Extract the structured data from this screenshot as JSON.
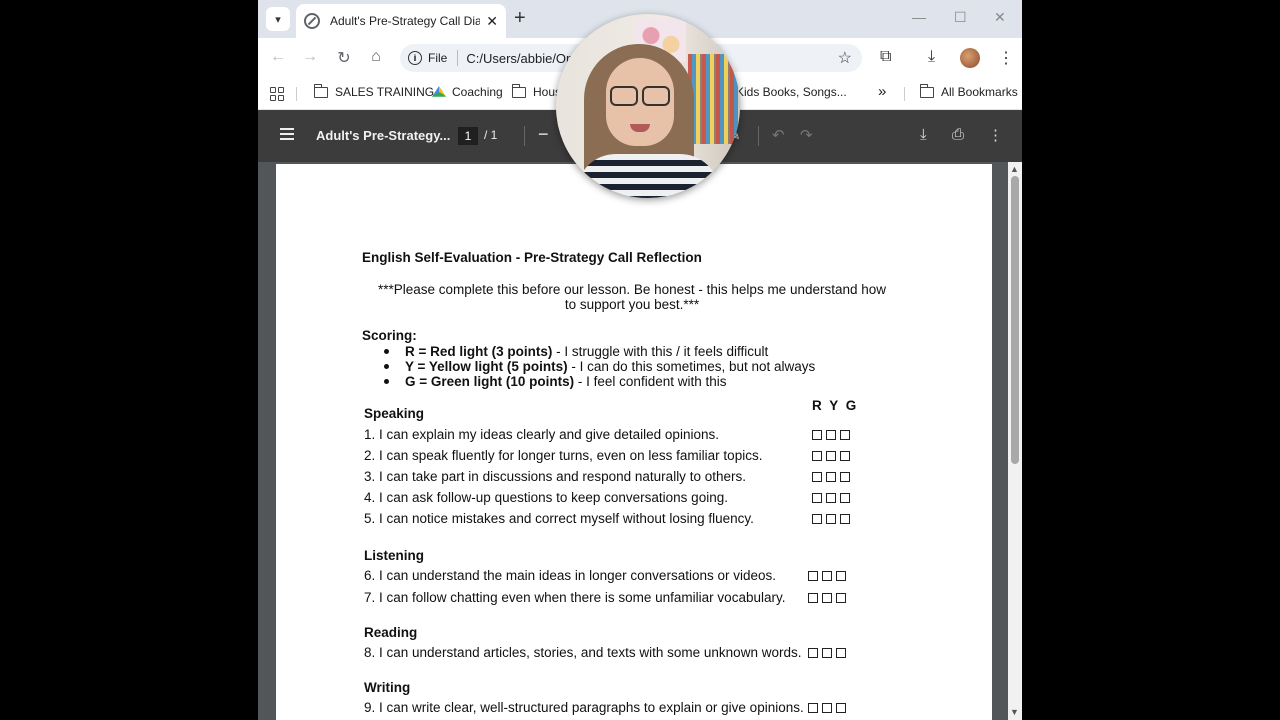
{
  "browser": {
    "tab_title": "Adult's Pre-Strategy Call Diagnos",
    "omnibox": {
      "scheme": "File",
      "url": "C:/Users/abbie/OneD                    l's/Adult's%20Pr..."
    },
    "bookmarks": [
      {
        "label": "SALES TRAINING",
        "icon": "folder-icon"
      },
      {
        "label": "Coaching",
        "icon": "google-drive-icon"
      },
      {
        "label": "Hous",
        "icon": "folder-icon"
      },
      {
        "label": "Kids Books, Songs...",
        "icon": "none"
      }
    ],
    "bookmarks_overflow": "»",
    "all_bookmarks": "All Bookmarks"
  },
  "pdf": {
    "title": "Adult's Pre-Strategy...",
    "page_current": "1",
    "page_total": "/ 1"
  },
  "document": {
    "title": "English Self-Evaluation - Pre-Strategy Call Reflection",
    "intro": "***Please complete this before our lesson. Be honest - this helps me understand how to support you best.***",
    "scoring_label": "Scoring:",
    "legend": [
      {
        "bold": "R = Red light (3 points)",
        "rest": " - I struggle with this / it feels difficult"
      },
      {
        "bold": "Y = Yellow light (5 points)",
        "rest": " - I can do this sometimes, but not always"
      },
      {
        "bold": "G = Green light (10 points)",
        "rest": " - I feel confident with this"
      }
    ],
    "ryg_header": "R Y G",
    "sections": {
      "speaking": "Speaking",
      "listening": "Listening",
      "reading": "Reading",
      "writing": "Writing"
    },
    "items": [
      "1. I can explain my ideas clearly and give detailed opinions.",
      "2. I can speak fluently for longer turns, even on less familiar topics.",
      "3. I can take part in discussions and respond naturally to others.",
      "4. I can ask follow-up questions to keep conversations going.",
      "5. I can notice mistakes and correct myself without losing fluency.",
      "6. I can understand the main ideas in longer conversations or videos.",
      "7. I can follow chatting even when there is some unfamiliar vocabulary.",
      "8. I can understand articles, stories, and texts with some unknown words.",
      "9. I can write clear, well-structured paragraphs to explain or give opinions."
    ]
  }
}
